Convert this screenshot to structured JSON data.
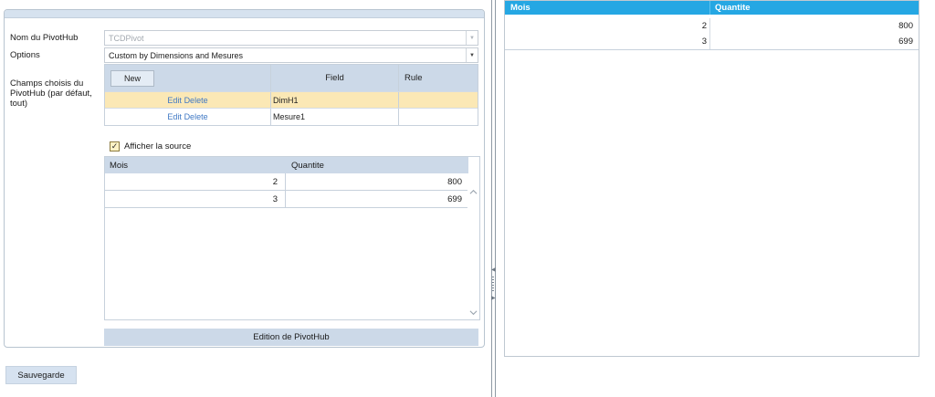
{
  "form": {
    "name_label": "Nom du PivotHub",
    "name_value": "TCDPivot",
    "options_label": "Options",
    "options_value": "Custom by Dimensions and Mesures",
    "fields_label": "Champs choisis du PivotHub (par défaut, tout)"
  },
  "fields_grid": {
    "new_label": "New",
    "columns": [
      "Field",
      "Rule"
    ],
    "rows": [
      {
        "edit": "Edit",
        "delete": "Delete",
        "field": "DimH1",
        "rule": "",
        "selected": true
      },
      {
        "edit": "Edit",
        "delete": "Delete",
        "field": "Mesure1",
        "rule": "",
        "selected": false
      }
    ]
  },
  "show_source": {
    "label": "Afficher la source",
    "checked": true
  },
  "source_grid": {
    "columns": [
      "Mois",
      "Quantite"
    ],
    "rows": [
      {
        "mois": "2",
        "quantite": "800"
      },
      {
        "mois": "3",
        "quantite": "699"
      }
    ]
  },
  "edition_label": "Edition de PivotHub",
  "save_label": "Sauvegarde",
  "result_grid": {
    "header_color": "#25a7e3",
    "columns": [
      "Mois",
      "Quantite"
    ],
    "rows": [
      {
        "mois": "2",
        "quantite": "800"
      },
      {
        "mois": "3",
        "quantite": "699"
      }
    ]
  },
  "icons": {
    "combo_arrow": "chevron-down-icon",
    "checkbox": "checkmark-icon",
    "scroll_up": "chevron-up-icon",
    "scroll_down": "chevron-down-icon"
  }
}
